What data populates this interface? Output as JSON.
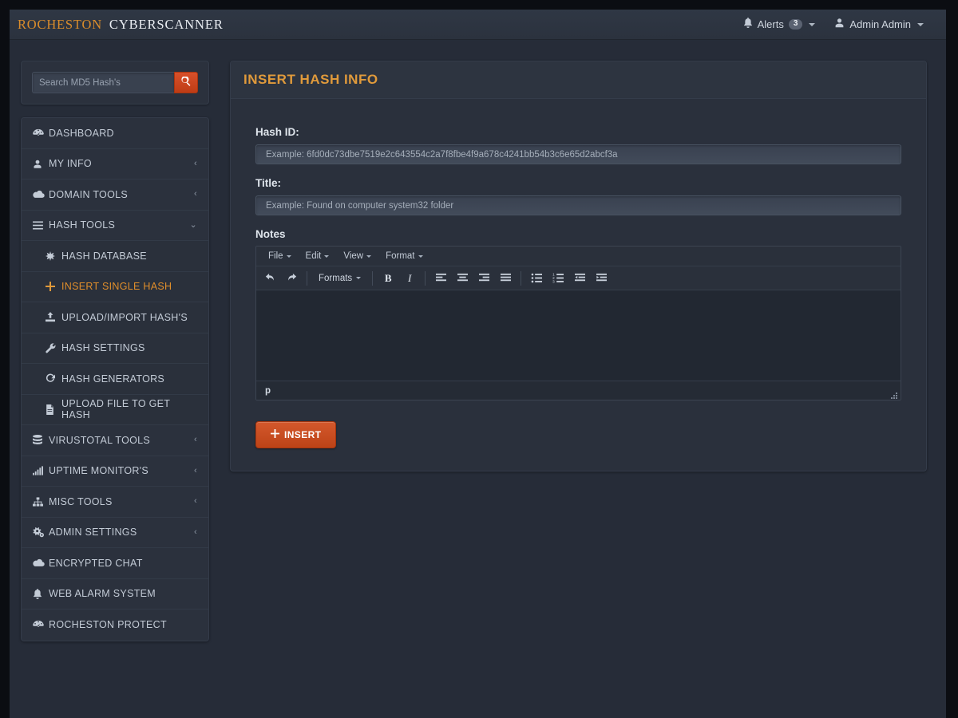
{
  "brand": {
    "company": "ROCHESTON",
    "product": "CYBERSCANNER"
  },
  "navbar": {
    "alerts_label": "Alerts",
    "alerts_count": "3",
    "user_label": "Admin Admin",
    "bell_icon": "bell-icon",
    "user_icon": "user-icon"
  },
  "sidebar": {
    "search": {
      "placeholder": "Search MD5 Hash's",
      "value": "",
      "button_icon": "search-icon"
    },
    "items": [
      {
        "label": "DASHBOARD",
        "icon": "dashboard-icon",
        "chevron": "",
        "sub": false,
        "active": false
      },
      {
        "label": "MY INFO",
        "icon": "user-icon",
        "chevron": "‹",
        "sub": false,
        "active": false
      },
      {
        "label": "DOMAIN TOOLS",
        "icon": "cloud-icon",
        "chevron": "‹",
        "sub": false,
        "active": false
      },
      {
        "label": "HASH TOOLS",
        "icon": "bars-icon",
        "chevron": "⌄",
        "sub": false,
        "active": false
      },
      {
        "label": "HASH DATABASE",
        "icon": "asterisk-icon",
        "chevron": "",
        "sub": true,
        "active": false
      },
      {
        "label": "INSERT SINGLE HASH",
        "icon": "plus-icon",
        "chevron": "",
        "sub": true,
        "active": true
      },
      {
        "label": "UPLOAD/IMPORT HASH'S",
        "icon": "upload-icon",
        "chevron": "",
        "sub": true,
        "active": false
      },
      {
        "label": "HASH SETTINGS",
        "icon": "wrench-icon",
        "chevron": "",
        "sub": true,
        "active": false
      },
      {
        "label": "HASH GENERATORS",
        "icon": "refresh-icon",
        "chevron": "",
        "sub": true,
        "active": false
      },
      {
        "label": "UPLOAD FILE TO GET HASH",
        "icon": "file-icon",
        "chevron": "",
        "sub": true,
        "active": false
      },
      {
        "label": "VIRUSTOTAL TOOLS",
        "icon": "database-icon",
        "chevron": "‹",
        "sub": false,
        "active": false
      },
      {
        "label": "UPTIME MONITOR'S",
        "icon": "signal-icon",
        "chevron": "‹",
        "sub": false,
        "active": false
      },
      {
        "label": "MISC TOOLS",
        "icon": "sitemap-icon",
        "chevron": "‹",
        "sub": false,
        "active": false
      },
      {
        "label": "ADMIN SETTINGS",
        "icon": "gears-icon",
        "chevron": "‹",
        "sub": false,
        "active": false
      },
      {
        "label": "ENCRYPTED CHAT",
        "icon": "cloud-icon",
        "chevron": "",
        "sub": false,
        "active": false
      },
      {
        "label": "WEB ALARM SYSTEM",
        "icon": "bell-icon",
        "chevron": "",
        "sub": false,
        "active": false
      },
      {
        "label": "ROCHESTON PROTECT",
        "icon": "dashboard-icon",
        "chevron": "",
        "sub": false,
        "active": false
      }
    ]
  },
  "panel": {
    "title": "INSERT HASH INFO",
    "hash_id": {
      "label": "Hash ID:",
      "placeholder": "Example: 6fd0dc73dbe7519e2c643554c2a7f8fbe4f9a678c4241bb54b3c6e65d2abcf3a",
      "value": ""
    },
    "title_field": {
      "label": "Title:",
      "placeholder": "Example: Found on computer system32 folder",
      "value": ""
    },
    "notes": {
      "label": "Notes",
      "menubar": [
        "File",
        "Edit",
        "View",
        "Format"
      ],
      "toolbar": {
        "undo": "undo-icon",
        "redo": "redo-icon",
        "formats_label": "Formats",
        "bold": "B",
        "italic": "I",
        "align_left": "align-left-icon",
        "align_center": "align-center-icon",
        "align_right": "align-right-icon",
        "align_justify": "align-justify-icon",
        "bullet_list": "bullet-list-icon",
        "numbered_list": "numbered-list-icon",
        "outdent": "outdent-icon",
        "indent": "indent-icon"
      },
      "content": "",
      "status_path": "p"
    },
    "submit_label": "INSERT",
    "submit_icon": "plus-icon"
  },
  "colors": {
    "accent_orange": "#e09a3b",
    "button_red": "#c8471c",
    "panel_bg": "#2a303c",
    "page_bg": "#262c38"
  }
}
